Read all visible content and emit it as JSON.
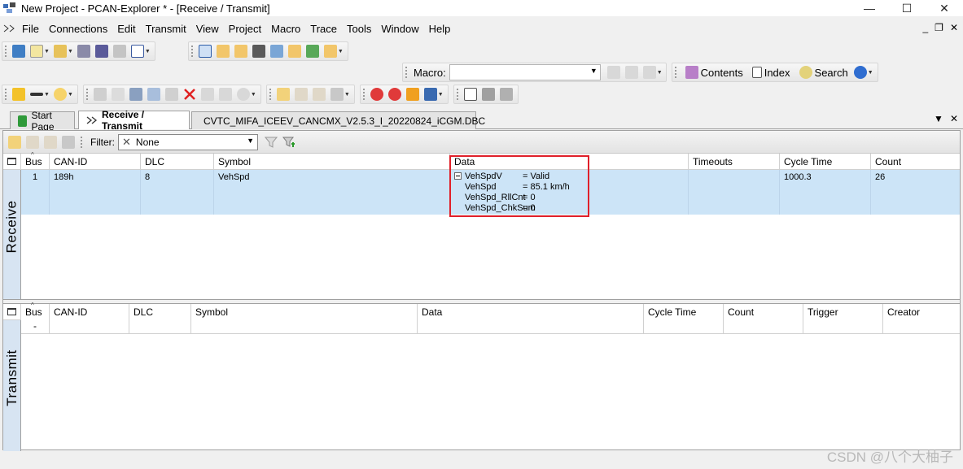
{
  "window": {
    "title": "New Project - PCAN-Explorer * - [Receive / Transmit]",
    "controls": {
      "minimize": "—",
      "maximize": "☐",
      "close": "✕"
    }
  },
  "menu": {
    "items": [
      "File",
      "Connections",
      "Edit",
      "Transmit",
      "View",
      "Project",
      "Macro",
      "Trace",
      "Tools",
      "Window",
      "Help"
    ],
    "mdi": {
      "minimize": "_",
      "restore": "❐",
      "close": "✕"
    }
  },
  "macro_toolbar": {
    "label": "Macro:",
    "value": "",
    "help": {
      "contents": "Contents",
      "index": "Index",
      "search": "Search"
    }
  },
  "tabs": {
    "start": "Start Page",
    "receive_transmit": "Receive / Transmit",
    "dbc": "CVTC_MIFA_ICEEV_CANCMX_V2.5.3_I_20220824_iCGM.DBC"
  },
  "filter": {
    "label": "Filter:",
    "value": "None"
  },
  "receive": {
    "side_label": "Receive",
    "columns": [
      "Bus",
      "CAN-ID",
      "DLC",
      "Symbol",
      "Data",
      "Timeouts",
      "Cycle Time",
      "Count"
    ],
    "row": {
      "bus": "1",
      "can_id": "189h",
      "dlc": "8",
      "symbol": "VehSpd",
      "cycle_time": "1000.3",
      "count": "26",
      "signals": [
        {
          "name": "VehSpdV",
          "value": "= Valid"
        },
        {
          "name": "VehSpd",
          "value": "= 85.1 km/h"
        },
        {
          "name": "VehSpd_RllCnt",
          "value": "= 0"
        },
        {
          "name": "VehSpd_ChkSum",
          "value": "= 0"
        }
      ]
    }
  },
  "transmit": {
    "side_label": "Transmit",
    "columns": [
      "Bus",
      "CAN-ID",
      "DLC",
      "Symbol",
      "Data",
      "Cycle Time",
      "Count",
      "Trigger",
      "Creator"
    ],
    "bus_sub": "-"
  },
  "watermark": "CSDN @八个大柚子",
  "colors": {
    "selection": "#cce4f7",
    "sidebar": "#d7e4f2",
    "highlight_box": "#e0202a"
  }
}
